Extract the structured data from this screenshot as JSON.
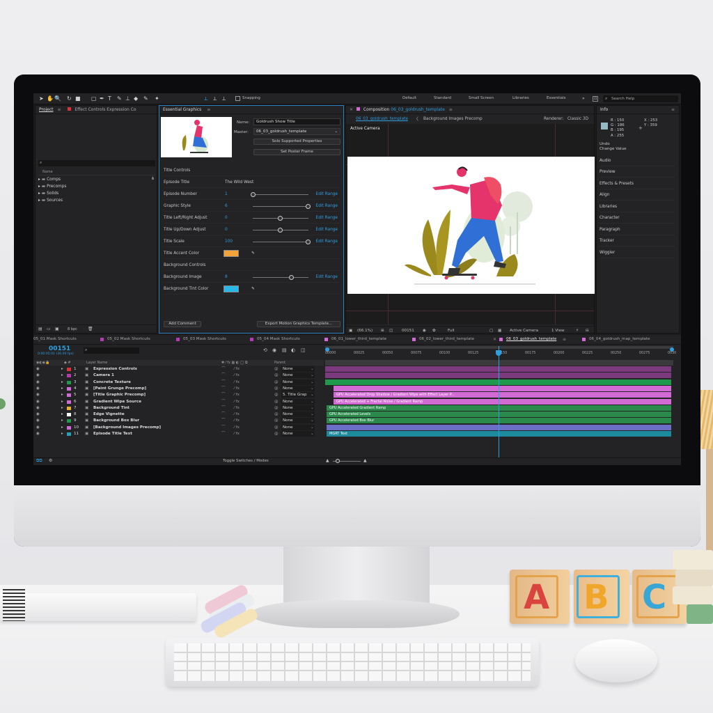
{
  "toolbar": {
    "snapping": "Snapping",
    "workspaces": [
      "Default",
      "Standard",
      "Small Screen",
      "Libraries",
      "Essentials"
    ],
    "search_placeholder": "Search Help"
  },
  "project": {
    "tab": "Project",
    "tab2": "Effect Controls Expression Co",
    "col_name": "Name",
    "folders": [
      "Comps",
      "Precomps",
      "Solids",
      "Sources"
    ],
    "bpc": "8 bpc"
  },
  "eg": {
    "tab": "Essential Graphics",
    "name_label": "Name:",
    "name_value": "Goldrush Show Title",
    "master_label": "Master:",
    "master_value": "06_03_goldrush_template",
    "solo_btn": "Solo Supported Properties",
    "poster_btn": "Set Poster Frame",
    "add_comment": "Add Comment",
    "export_btn": "Export Motion Graphics Template...",
    "rows": [
      {
        "label": "Title Controls"
      },
      {
        "label": "Episode Title",
        "value": "The Wild West"
      },
      {
        "label": "Episode Number",
        "value": "1",
        "edit": "Edit Range"
      },
      {
        "label": "Graphic Style",
        "value": "6",
        "edit": "Edit Range"
      },
      {
        "label": "Title Left/Right Adjust",
        "value": "0",
        "edit": "Edit Range"
      },
      {
        "label": "Title Up/Down Adjust",
        "value": "0",
        "edit": "Edit Range"
      },
      {
        "label": "Title Scale",
        "value": "100",
        "edit": "Edit Range"
      },
      {
        "label": "Title Accent Color"
      },
      {
        "label": "Background Controls"
      },
      {
        "label": "Background Image",
        "value": "8",
        "edit": "Edit Range"
      },
      {
        "label": "Background Tint Color"
      }
    ]
  },
  "comp": {
    "tab_prefix": "Composition",
    "tab_name": "06_03_goldrush_template",
    "crumb1": "06_03_goldrush_template",
    "crumb2": "Background Images Precomp",
    "renderer_label": "Renderer:",
    "renderer": "Classic 3D",
    "camera": "Active Camera",
    "zoom": "(66.1%)",
    "frame": "00151",
    "quality": "Full",
    "view_cam": "Active Camera",
    "views": "1 View"
  },
  "info": {
    "tab": "Info",
    "r": "R : 150",
    "g": "G : 186",
    "b": "B : 195",
    "a": "A : 255",
    "x": "X : 253",
    "y": "Y : 359",
    "undo": "Undo",
    "undo_action": "Change Value",
    "swatch": "#96bac3",
    "panels": [
      "Audio",
      "Preview",
      "Effects & Presets",
      "Align",
      "Libraries",
      "Character",
      "Paragraph",
      "Tracker",
      "Wiggler"
    ]
  },
  "timeline": {
    "tabs": [
      "05_01 Mask Shortcuts",
      "05_02 Mask Shortcuts",
      "05_03 Mask Shortcuts",
      "05_04 Mask Shortcuts",
      "06_01_lower_third_template",
      "06_02_lower_third_template",
      "06_03_goldrush_template",
      "06_04_goldrush_map_template"
    ],
    "timecode": "00151",
    "timecode_sub": "0:00:05:01 (30.00 fps)",
    "layer_name_hdr": "Layer Name",
    "parent_hdr": "Parent",
    "toggle": "Toggle Switches / Modes",
    "ruler": [
      "00000",
      "00025",
      "00050",
      "00075",
      "00100",
      "00125",
      "00150",
      "00175",
      "00200",
      "00225",
      "00250",
      "00275",
      "0030"
    ],
    "layers": [
      {
        "num": "1",
        "name": "Expression Controls",
        "color": "#d8343a",
        "parent": "None"
      },
      {
        "num": "2",
        "name": "Camera 1",
        "color": "#b53ab3",
        "parent": "None"
      },
      {
        "num": "3",
        "name": "Concrete Texture",
        "color": "#1f9a4c",
        "parent": "None"
      },
      {
        "num": "4",
        "name": "[Paint Grunge Precomp]",
        "color": "#d16bd3",
        "parent": "None"
      },
      {
        "num": "5",
        "name": "[Title Graphic Precomp]",
        "color": "#d16bd3",
        "parent": "5. Title Grap"
      },
      {
        "num": "6",
        "name": "Gradient Wipe Source",
        "color": "#d16bd3",
        "parent": "None"
      },
      {
        "num": "7",
        "name": "Background Tint",
        "color": "#e8b12a",
        "parent": "None"
      },
      {
        "num": "8",
        "name": "Edge Vignette",
        "color": "#ffffff",
        "parent": "None"
      },
      {
        "num": "9",
        "name": "Background Box Blur",
        "color": "#1f9a4c",
        "parent": "None"
      },
      {
        "num": "10",
        "name": "[Background Images Precomp]",
        "color": "#d16bd3",
        "parent": "None"
      },
      {
        "num": "11",
        "name": "Episode Title Text",
        "color": "#27a0b8",
        "parent": "None"
      }
    ],
    "bars": [
      "",
      "",
      "",
      "GPU Accelerated Drop Shadow / Gradient Wipe with Effect Layer P...",
      "GPU Accelerated + Fractal Noise / Gradient Ramp",
      "GPU Accelerated Gradient Ramp",
      "GPU Accelerated Levels",
      "GPU Accelerated Box Blur",
      "",
      "MGRT Text"
    ]
  },
  "blocks": {
    "a": "A",
    "b": "B",
    "c": "C"
  }
}
